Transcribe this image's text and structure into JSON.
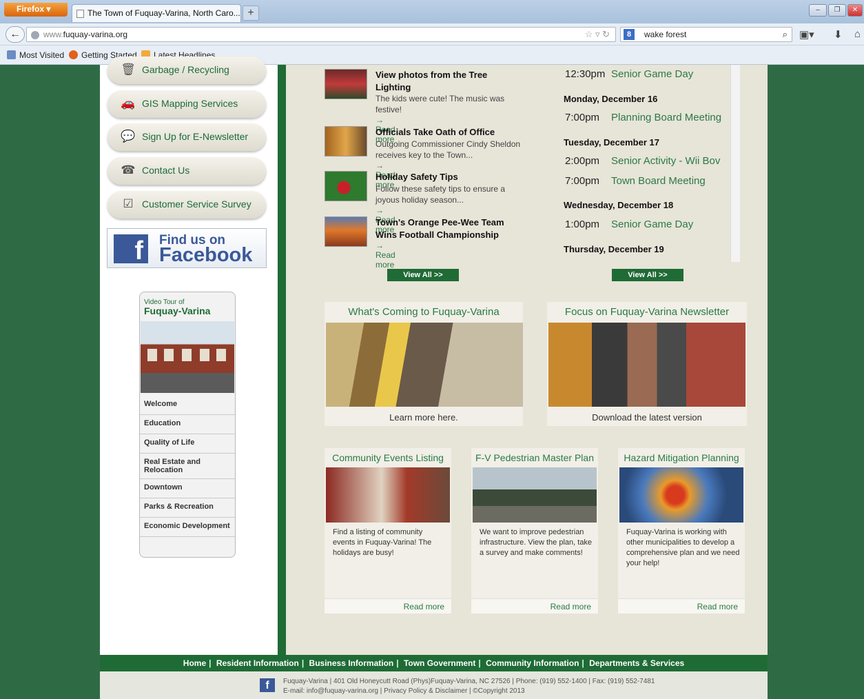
{
  "browser": {
    "app_button": "Firefox ▾",
    "tab_title": "The Town of Fuquay-Varina, North Caro...",
    "new_tab": "+",
    "url_gray": "www.",
    "url_host": "fuquay-varina.org",
    "search_value": "wake forest",
    "bookmarks": [
      "Most Visited",
      "Getting Started",
      "Latest Headlines"
    ]
  },
  "sidebar": {
    "quick_links": [
      "Garbage / Recycling",
      "GIS Mapping Services",
      "Sign Up for E-Newsletter",
      "Contact Us",
      "Customer Service Survey"
    ],
    "facebook_line1": "Find us on",
    "facebook_line2": "Facebook",
    "video_pre": "Video Tour of",
    "video_title": "Fuquay-Varina",
    "video_menu": [
      "Welcome",
      "Education",
      "Quality of Life",
      "Real Estate and Relocation",
      "Downtown",
      "Parks & Recreation",
      "Economic Development"
    ]
  },
  "news": [
    {
      "title": "View photos from the Tree Lighting",
      "text": "The kids were cute! The music was festive!",
      "more": "→ Read more"
    },
    {
      "title": "Officials Take Oath of Office",
      "text": "Outgoing Commissioner Cindy Sheldon receives key to the Town...",
      "more": "→ Read more"
    },
    {
      "title": "Holiday Safety Tips",
      "text": "Follow these safety tips to ensure a joyous holiday season...",
      "more": "→ Read more"
    },
    {
      "title": "Town's Orange Pee-Wee Team Wins Football Championship",
      "text": "",
      "more": "→ Read more"
    }
  ],
  "events": {
    "first_time": "12:30pm",
    "first_title": "Senior Game Day",
    "days": [
      {
        "day": "Monday, December 16",
        "items": [
          {
            "time": "7:00pm",
            "title": "Planning Board Meeting"
          }
        ]
      },
      {
        "day": "Tuesday, December 17",
        "items": [
          {
            "time": "2:00pm",
            "title": "Senior Activity - Wii Bov"
          },
          {
            "time": "7:00pm",
            "title": "Town Board Meeting"
          }
        ]
      },
      {
        "day": "Wednesday, December 18",
        "items": [
          {
            "time": "1:00pm",
            "title": "Senior Game Day"
          }
        ]
      },
      {
        "day": "Thursday, December 19",
        "items": []
      }
    ]
  },
  "view_all": "View All >>",
  "features": [
    {
      "title": "What's Coming to Fuquay-Varina",
      "caption": "Learn more here."
    },
    {
      "title": "Focus on Fuquay-Varina Newsletter",
      "caption": "Download the latest version"
    }
  ],
  "cards": [
    {
      "title": "Community Events Listing",
      "text": "Find a listing of community events in Fuquay-Varina! The holidays are busy!",
      "more": "Read more"
    },
    {
      "title": "F-V Pedestrian Master Plan",
      "text": "We want to improve pedestrian infrastructure. View the plan, take a survey and make comments!",
      "more": "Read more"
    },
    {
      "title": "Hazard Mitigation Planning",
      "text": "Fuquay-Varina is working with other municipalities to develop a comprehensive plan and we need your help!",
      "more": "Read more"
    }
  ],
  "footer": {
    "nav": [
      "Home",
      "Resident Information",
      "Business Information",
      "Town Government",
      "Community Information",
      "Departments & Services"
    ],
    "line1": "Fuquay-Varina | 401 Old Honeycutt Road (Phys)Fuquay-Varina, NC 27526 | Phone: (919) 552-1400 | Fax: (919) 552-7481",
    "line2": "E-mail: info@fuquay-varina.org | Privacy Policy & Disclaimer | ©Copyright 2013"
  }
}
